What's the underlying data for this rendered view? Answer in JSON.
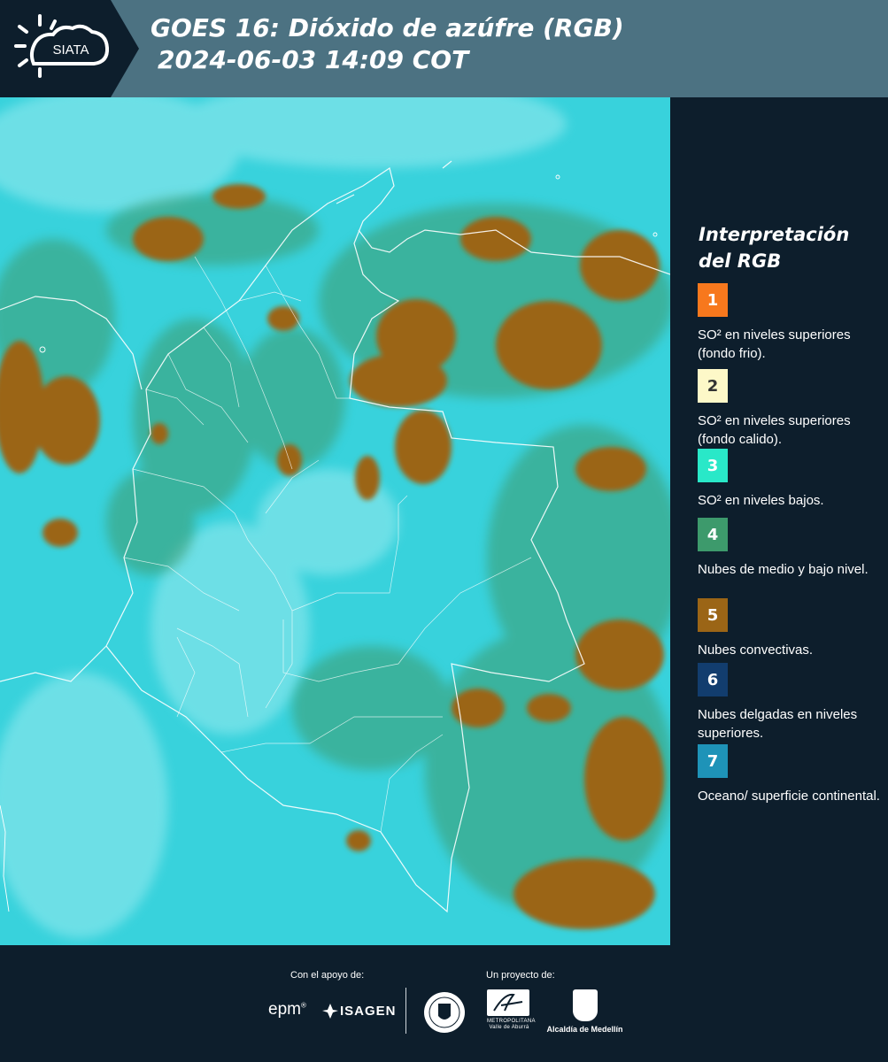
{
  "header": {
    "logo_text": "SIATA",
    "title_line1": "GOES 16: Dióxido de azúfre (RGB)",
    "title_line2": "2024-06-03 14:09 COT"
  },
  "legend": {
    "title": "Interpretación del RGB",
    "items": [
      {
        "number": "1",
        "color": "#f7781d",
        "text": "SO² en niveles superiores (fondo frio)."
      },
      {
        "number": "2",
        "color": "#fdf8c8",
        "text": "SO² en niveles superiores (fondo calido)."
      },
      {
        "number": "3",
        "color": "#29e8c8",
        "text": "SO² en niveles bajos."
      },
      {
        "number": "4",
        "color": "#3d9a6c",
        "text": "Nubes de medio y bajo nivel."
      },
      {
        "number": "5",
        "color": "#9b6516",
        "text": "Nubes convectivas."
      },
      {
        "number": "6",
        "color": "#123d6e",
        "text": "Nubes delgadas en niveles superiores."
      },
      {
        "number": "7",
        "color": "#1e93b8",
        "text": "Oceano/ superficie continental."
      }
    ]
  },
  "footer": {
    "support_label": "Con el apoyo de:",
    "project_label": "Un proyecto de:",
    "epm": "epm",
    "isagen": "ISAGEN",
    "metropolitana_line1": "METROPOLITANA",
    "metropolitana_line2": "Valle de Aburrá",
    "alcaldia": "Alcaldía de Medellín"
  },
  "colors": {
    "header_bg": "#4c7282",
    "logo_panel": "#0d1e2c",
    "page_bg": "#0d1e2c",
    "map_cyan": "#38d2dc",
    "cloud_convective": "#9b6516",
    "cloud_green": "#3d9a6c"
  }
}
